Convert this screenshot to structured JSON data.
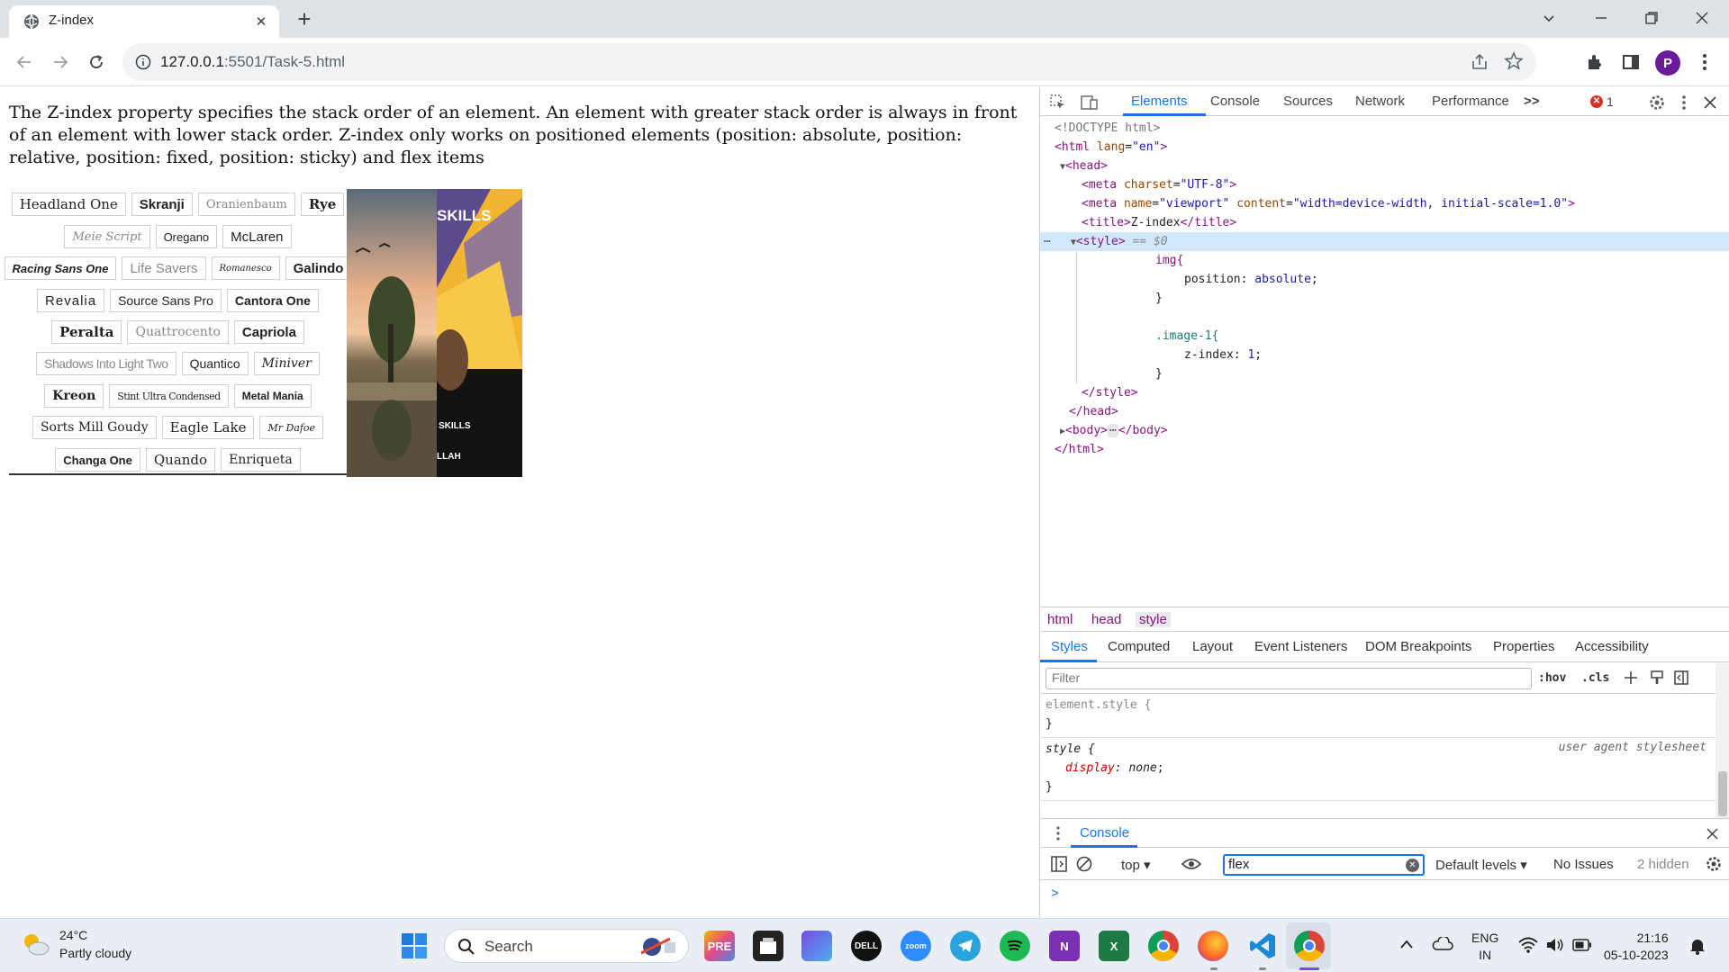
{
  "browser": {
    "tab_title": "Z-index",
    "url_host": "127.0.0.1",
    "url_path": ":5501/Task-5.html",
    "avatar_letter": "P",
    "accent": "#1a73e8"
  },
  "page": {
    "paragraph": "The Z-index property specifies the stack order of an element. An element with greater stack order is always in front of an element with lower stack order. Z-index only works on positioned elements (position: absolute, position: relative, position: fixed, position: sticky) and flex items",
    "font_rows": [
      [
        "Headland One",
        "Skranji",
        "Oranienbaum",
        "Rye"
      ],
      [
        "Meie Script",
        "Oregano",
        "McLaren"
      ],
      [
        "Racing Sans One",
        "Life Savers",
        "Romanesco",
        "Galindo"
      ],
      [
        "Revalia",
        "Source Sans Pro",
        "Cantora One"
      ],
      [
        "Peralta",
        "Quattrocento",
        "Capriola"
      ],
      [
        "Shadows Into Light Two",
        "Quantico",
        "Miniver"
      ],
      [
        "Kreon",
        "Stint Ultra Condensed",
        "Metal Mania"
      ],
      [
        "Sorts Mill Goudy",
        "Eagle Lake",
        "Mr Dafoe"
      ],
      [
        "Changa One",
        "Quando",
        "Enriqueta"
      ]
    ],
    "photo_overlay_1": "SKILLS",
    "photo_overlay_2": "SKILLS",
    "photo_overlay_3": "LLAH"
  },
  "devtools": {
    "tabs": [
      "Elements",
      "Console",
      "Sources",
      "Network",
      "Performance"
    ],
    "more_tabs": ">>",
    "error_count": "1",
    "dom_lines": {
      "doctype": "<!DOCTYPE html>",
      "html_open_tag": "<html",
      "html_lang_attr": " lang",
      "html_lang_val": "\"en\"",
      "head_open": "<head>",
      "meta1_tag": "<meta",
      "meta1_attr": " charset",
      "meta1_val": "\"UTF-8\"",
      "meta2_tag": "<meta",
      "meta2_attr1": " name",
      "meta2_val1": "\"viewport\"",
      "meta2_attr2": " content",
      "meta2_val2": "\"width=device-width, initial-scale=1.0\"",
      "title_open": "<title>",
      "title_text": "Z-index",
      "title_close": "</title>",
      "style_open": "<style>",
      "style_marker": " == $0",
      "css1": "img{",
      "css2_prop": "position",
      "css2_val": "absolute",
      "css3": "}",
      "css4": ".image-1{",
      "css5_prop": "z-index",
      "css5_val": "1",
      "css6": "}",
      "style_close": "</style>",
      "head_close": "</head>",
      "body_open": "<body>",
      "body_ellipsis": "⋯",
      "body_close": "</body>",
      "html_close": "</html>"
    },
    "breadcrumbs": [
      "html",
      "head",
      "style"
    ],
    "subtabs": [
      "Styles",
      "Computed",
      "Layout",
      "Event Listeners",
      "DOM Breakpoints",
      "Properties",
      "Accessibility"
    ],
    "filter_placeholder": "Filter",
    "hov": ":hov",
    "cls": ".cls",
    "rules": {
      "element_style": "element.style {",
      "close": "}",
      "style_selector": "style {",
      "ua_label": "user agent stylesheet",
      "display_prop": "display",
      "display_val": "none"
    },
    "drawer": {
      "title": "Console",
      "context": "top",
      "filter_value": "flex",
      "levels": "Default levels",
      "issues": "No Issues",
      "hidden": "2 hidden",
      "prompt": ">"
    }
  },
  "taskbar": {
    "temperature": "24°C",
    "weather": "Partly cloudy",
    "search": "Search",
    "lang1": "ENG",
    "lang2": "IN",
    "time": "21:16",
    "date": "05-10-2023"
  }
}
